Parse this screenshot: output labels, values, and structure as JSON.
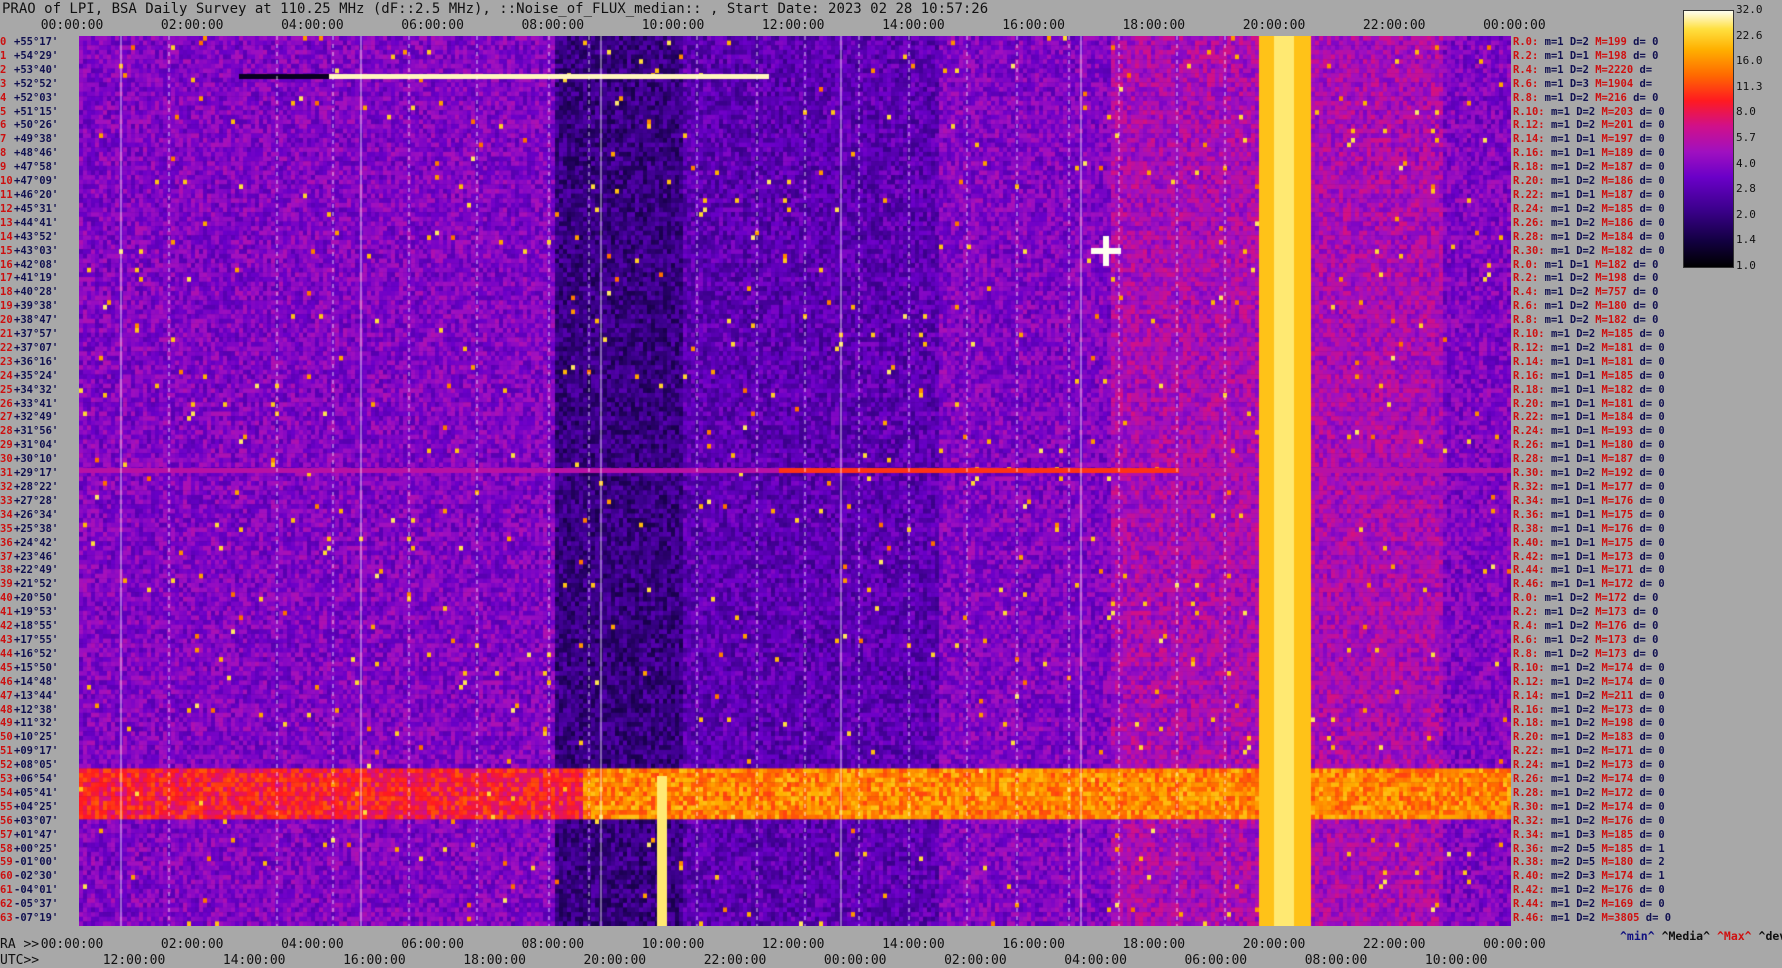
{
  "title": "PRAO of LPI, BSA Daily Survey at 110.25 MHz (dF::2.5 MHz), ::Noise_of_FLUX_median:: , Start Date: 2023 02 28 10:57:26",
  "top_ticks": [
    "00:00:00",
    "02:00:00",
    "04:00:00",
    "06:00:00",
    "08:00:00",
    "10:00:00",
    "12:00:00",
    "14:00:00",
    "16:00:00",
    "18:00:00",
    "20:00:00",
    "22:00:00",
    "00:00:00"
  ],
  "ra_label": "RA >>",
  "ra_ticks": [
    "00:00:00",
    "02:00:00",
    "04:00:00",
    "06:00:00",
    "08:00:00",
    "10:00:00",
    "12:00:00",
    "14:00:00",
    "16:00:00",
    "18:00:00",
    "20:00:00",
    "22:00:00",
    "00:00:00"
  ],
  "utc_label": "UTC>>",
  "utc_ticks": [
    "12:00:00",
    "14:00:00",
    "16:00:00",
    "18:00:00",
    "20:00:00",
    "22:00:00",
    "00:00:00",
    "02:00:00",
    "04:00:00",
    "06:00:00",
    "08:00:00",
    "10:00:00"
  ],
  "declinations": [
    [
      "0",
      "+55°17'"
    ],
    [
      "1",
      "+54°29'"
    ],
    [
      "2",
      "+53°40'"
    ],
    [
      "3",
      "+52°52'"
    ],
    [
      "4",
      "+52°03'"
    ],
    [
      "5",
      "+51°15'"
    ],
    [
      "6",
      "+50°26'"
    ],
    [
      "7",
      "+49°38'"
    ],
    [
      "8",
      "+48°46'"
    ],
    [
      "9",
      "+47°58'"
    ],
    [
      "10",
      "+47°09'"
    ],
    [
      "11",
      "+46°20'"
    ],
    [
      "12",
      "+45°31'"
    ],
    [
      "13",
      "+44°41'"
    ],
    [
      "14",
      "+43°52'"
    ],
    [
      "15",
      "+43°03'"
    ],
    [
      "16",
      "+42°08'"
    ],
    [
      "17",
      "+41°19'"
    ],
    [
      "18",
      "+40°28'"
    ],
    [
      "19",
      "+39°38'"
    ],
    [
      "20",
      "+38°47'"
    ],
    [
      "21",
      "+37°57'"
    ],
    [
      "22",
      "+37°07'"
    ],
    [
      "23",
      "+36°16'"
    ],
    [
      "24",
      "+35°24'"
    ],
    [
      "25",
      "+34°32'"
    ],
    [
      "26",
      "+33°41'"
    ],
    [
      "27",
      "+32°49'"
    ],
    [
      "28",
      "+31°56'"
    ],
    [
      "29",
      "+31°04'"
    ],
    [
      "30",
      "+30°10'"
    ],
    [
      "31",
      "+29°17'"
    ],
    [
      "32",
      "+28°22'"
    ],
    [
      "33",
      "+27°28'"
    ],
    [
      "34",
      "+26°34'"
    ],
    [
      "35",
      "+25°38'"
    ],
    [
      "36",
      "+24°42'"
    ],
    [
      "37",
      "+23°46'"
    ],
    [
      "38",
      "+22°49'"
    ],
    [
      "39",
      "+21°52'"
    ],
    [
      "40",
      "+20°50'"
    ],
    [
      "41",
      "+19°53'"
    ],
    [
      "42",
      "+18°55'"
    ],
    [
      "43",
      "+17°55'"
    ],
    [
      "44",
      "+16°52'"
    ],
    [
      "45",
      "+15°50'"
    ],
    [
      "46",
      "+14°48'"
    ],
    [
      "47",
      "+13°44'"
    ],
    [
      "48",
      "+12°38'"
    ],
    [
      "49",
      "+11°32'"
    ],
    [
      "50",
      "+10°25'"
    ],
    [
      "51",
      "+09°17'"
    ],
    [
      "52",
      "+08°05'"
    ],
    [
      "53",
      "+06°54'"
    ],
    [
      "54",
      "+05°41'"
    ],
    [
      "55",
      "+04°25'"
    ],
    [
      "56",
      "+03°07'"
    ],
    [
      "57",
      "+01°47'"
    ],
    [
      "58",
      "+00°25'"
    ],
    [
      "59",
      "-01°00'"
    ],
    [
      "60",
      "-02°30'"
    ],
    [
      "61",
      "-04°01'"
    ],
    [
      "62",
      "-05°37'"
    ],
    [
      "63",
      "-07°19'"
    ]
  ],
  "right_rows": [
    [
      "R.0:",
      "m=1",
      "D=2",
      "M=199",
      "d= 0"
    ],
    [
      "R.2:",
      "m=1",
      "D=1",
      "M=198",
      "d= 0"
    ],
    [
      "R.4:",
      "m=1",
      "D=2",
      "M=2220",
      "d="
    ],
    [
      "R.6:",
      "m=1",
      "D=3",
      "M=1904",
      "d="
    ],
    [
      "R.8:",
      "m=1",
      "D=2",
      "M=216",
      "d= 0"
    ],
    [
      "R.10:",
      "m=1",
      "D=2",
      "M=203",
      "d= 0"
    ],
    [
      "R.12:",
      "m=1",
      "D=2",
      "M=201",
      "d= 0"
    ],
    [
      "R.14:",
      "m=1",
      "D=1",
      "M=197",
      "d= 0"
    ],
    [
      "R.16:",
      "m=1",
      "D=1",
      "M=189",
      "d= 0"
    ],
    [
      "R.18:",
      "m=1",
      "D=2",
      "M=187",
      "d= 0"
    ],
    [
      "R.20:",
      "m=1",
      "D=2",
      "M=186",
      "d= 0"
    ],
    [
      "R.22:",
      "m=1",
      "D=1",
      "M=187",
      "d= 0"
    ],
    [
      "R.24:",
      "m=1",
      "D=2",
      "M=185",
      "d= 0"
    ],
    [
      "R.26:",
      "m=1",
      "D=2",
      "M=186",
      "d= 0"
    ],
    [
      "R.28:",
      "m=1",
      "D=2",
      "M=184",
      "d= 0"
    ],
    [
      "R.30:",
      "m=1",
      "D=2",
      "M=182",
      "d= 0"
    ],
    [
      "R.0:",
      "m=1",
      "D=1",
      "M=182",
      "d= 0"
    ],
    [
      "R.2:",
      "m=1",
      "D=2",
      "M=198",
      "d= 0"
    ],
    [
      "R.4:",
      "m=1",
      "D=2",
      "M=757",
      "d= 0"
    ],
    [
      "R.6:",
      "m=1",
      "D=2",
      "M=180",
      "d= 0"
    ],
    [
      "R.8:",
      "m=1",
      "D=2",
      "M=182",
      "d= 0"
    ],
    [
      "R.10:",
      "m=1",
      "D=2",
      "M=185",
      "d= 0"
    ],
    [
      "R.12:",
      "m=1",
      "D=2",
      "M=181",
      "d= 0"
    ],
    [
      "R.14:",
      "m=1",
      "D=1",
      "M=181",
      "d= 0"
    ],
    [
      "R.16:",
      "m=1",
      "D=1",
      "M=185",
      "d= 0"
    ],
    [
      "R.18:",
      "m=1",
      "D=1",
      "M=182",
      "d= 0"
    ],
    [
      "R.20:",
      "m=1",
      "D=1",
      "M=181",
      "d= 0"
    ],
    [
      "R.22:",
      "m=1",
      "D=1",
      "M=184",
      "d= 0"
    ],
    [
      "R.24:",
      "m=1",
      "D=1",
      "M=193",
      "d= 0"
    ],
    [
      "R.26:",
      "m=1",
      "D=1",
      "M=180",
      "d= 0"
    ],
    [
      "R.28:",
      "m=1",
      "D=1",
      "M=187",
      "d= 0"
    ],
    [
      "R.30:",
      "m=1",
      "D=2",
      "M=192",
      "d= 0"
    ],
    [
      "R.32:",
      "m=1",
      "D=1",
      "M=177",
      "d= 0"
    ],
    [
      "R.34:",
      "m=1",
      "D=1",
      "M=176",
      "d= 0"
    ],
    [
      "R.36:",
      "m=1",
      "D=1",
      "M=175",
      "d= 0"
    ],
    [
      "R.38:",
      "m=1",
      "D=1",
      "M=176",
      "d= 0"
    ],
    [
      "R.40:",
      "m=1",
      "D=1",
      "M=175",
      "d= 0"
    ],
    [
      "R.42:",
      "m=1",
      "D=1",
      "M=173",
      "d= 0"
    ],
    [
      "R.44:",
      "m=1",
      "D=1",
      "M=171",
      "d= 0"
    ],
    [
      "R.46:",
      "m=1",
      "D=1",
      "M=172",
      "d= 0"
    ],
    [
      "R.0:",
      "m=1",
      "D=2",
      "M=172",
      "d= 0"
    ],
    [
      "R.2:",
      "m=1",
      "D=2",
      "M=173",
      "d= 0"
    ],
    [
      "R.4:",
      "m=1",
      "D=2",
      "M=176",
      "d= 0"
    ],
    [
      "R.6:",
      "m=1",
      "D=2",
      "M=173",
      "d= 0"
    ],
    [
      "R.8:",
      "m=1",
      "D=2",
      "M=173",
      "d= 0"
    ],
    [
      "R.10:",
      "m=1",
      "D=2",
      "M=174",
      "d= 0"
    ],
    [
      "R.12:",
      "m=1",
      "D=2",
      "M=174",
      "d= 0"
    ],
    [
      "R.14:",
      "m=1",
      "D=2",
      "M=211",
      "d= 0"
    ],
    [
      "R.16:",
      "m=1",
      "D=2",
      "M=173",
      "d= 0"
    ],
    [
      "R.18:",
      "m=1",
      "D=2",
      "M=198",
      "d= 0"
    ],
    [
      "R.20:",
      "m=1",
      "D=2",
      "M=183",
      "d= 0"
    ],
    [
      "R.22:",
      "m=1",
      "D=2",
      "M=171",
      "d= 0"
    ],
    [
      "R.24:",
      "m=1",
      "D=2",
      "M=173",
      "d= 0"
    ],
    [
      "R.26:",
      "m=1",
      "D=2",
      "M=174",
      "d= 0"
    ],
    [
      "R.28:",
      "m=1",
      "D=2",
      "M=172",
      "d= 0"
    ],
    [
      "R.30:",
      "m=1",
      "D=2",
      "M=174",
      "d= 0"
    ],
    [
      "R.32:",
      "m=1",
      "D=2",
      "M=176",
      "d= 0"
    ],
    [
      "R.34:",
      "m=1",
      "D=3",
      "M=185",
      "d= 0"
    ],
    [
      "R.36:",
      "m=2",
      "D=5",
      "M=185",
      "d= 1"
    ],
    [
      "R.38:",
      "m=2",
      "D=5",
      "M=180",
      "d= 2"
    ],
    [
      "R.40:",
      "m=2",
      "D=3",
      "M=174",
      "d= 1"
    ],
    [
      "R.42:",
      "m=1",
      "D=2",
      "M=176",
      "d= 0"
    ],
    [
      "R.44:",
      "m=1",
      "D=2",
      "M=169",
      "d= 0"
    ],
    [
      "R.46:",
      "m=1",
      "D=2",
      "M=3805",
      "d= 0"
    ]
  ],
  "colorbar_labels": [
    "32.0",
    "22.6",
    "16.0",
    "11.3",
    "8.0",
    "5.7",
    "4.0",
    "2.8",
    "2.0",
    "1.4",
    "1.0"
  ],
  "legend": {
    "min": "^min^",
    "median": "^Media^",
    "max": "^Max^",
    "devia": "^devia^"
  }
}
